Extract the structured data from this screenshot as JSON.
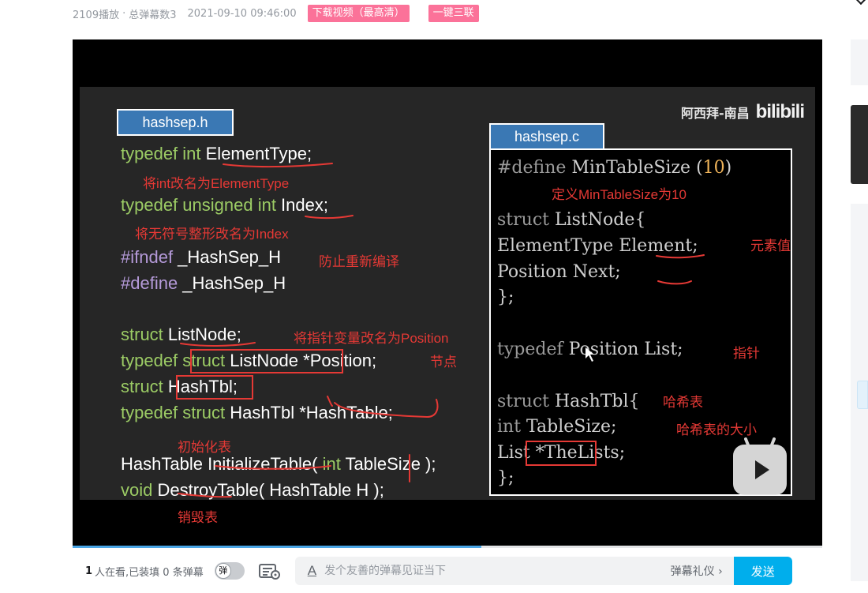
{
  "meta": {
    "plays": "2109播放",
    "separator": "·",
    "danmaku_total": "总弹幕数3",
    "datetime": "2021-09-10 09:46:00",
    "download_button": "下载视频（最高清）",
    "triple_button": "一键三联"
  },
  "slide": {
    "brand_author": "阿西拜-南昌",
    "brand_logo": "bilibili",
    "left_label": "hashsep.h",
    "right_label": "hashsep.c",
    "left_code": [
      {
        "kw": "typedef int",
        "rest": " ElementType;"
      },
      {
        "kw": "typedef unsigned int",
        "rest": " Index;"
      },
      {
        "kw": "#ifndef",
        "rest": " _HashSep_H"
      },
      {
        "kw": "#define",
        "rest": " _HashSep_H"
      },
      {
        "kw": "struct",
        "rest": " ListNode;"
      },
      {
        "kw": "typedef",
        "mid": " struct",
        "rest": " ListNode *Position;"
      },
      {
        "kw": "struct",
        "rest": " HashTbl;"
      },
      {
        "kw": "typedef struct",
        "rest": " HashTbl *HashTable;"
      },
      {
        "pre": "HashTable InitializeTable( ",
        "kw": "int",
        "rest": " TableSize );"
      },
      {
        "kw": "void",
        "rest": " DestroyTable( HashTable H );"
      }
    ],
    "left_annotations": [
      "将int改名为ElementType",
      "将无符号整形改名为Index",
      "防止重新编译",
      "将指针变量改名为Position",
      "节点",
      "初始化表",
      "销毁表"
    ],
    "right_code": [
      {
        "kw": "#define",
        "rest": " MinTableSize (",
        "num": "10",
        "end": ")"
      },
      {
        "kw": "struct",
        "rest": " ListNode{"
      },
      {
        "kw": "",
        "rest": "   ElementType Element;"
      },
      {
        "kw": "",
        "rest": "   Position    Next;"
      },
      {
        "kw": "",
        "rest": "};"
      },
      {
        "kw": "typedef",
        "rest": " Position List;"
      },
      {
        "kw": "struct",
        "rest": " HashTbl{"
      },
      {
        "kw": "   int",
        "rest": " TableSize;"
      },
      {
        "kw": "",
        "rest": "   List *TheLists;"
      },
      {
        "kw": "",
        "rest": "};"
      }
    ],
    "right_annotations": [
      "定义MinTableSize为10",
      "元素值",
      "指针",
      "哈希表",
      "哈希表的大小"
    ]
  },
  "player": {
    "progress_fraction": 0.545,
    "viewers_count": "1",
    "viewers_text": "人在看,已装填 0 条弹幕",
    "danmaku_toggle_label": "弹",
    "input_placeholder": "发个友善的弹幕见证当下",
    "font_icon": "A",
    "etiquette_link": "弹幕礼仪 ›",
    "send_button": "发送"
  },
  "colors": {
    "accent_pink": "#fb7299",
    "accent_blue": "#00aeec",
    "annotation_red": "#e53935",
    "slide_bg": "#262626",
    "label_blue": "#3a78b4"
  }
}
